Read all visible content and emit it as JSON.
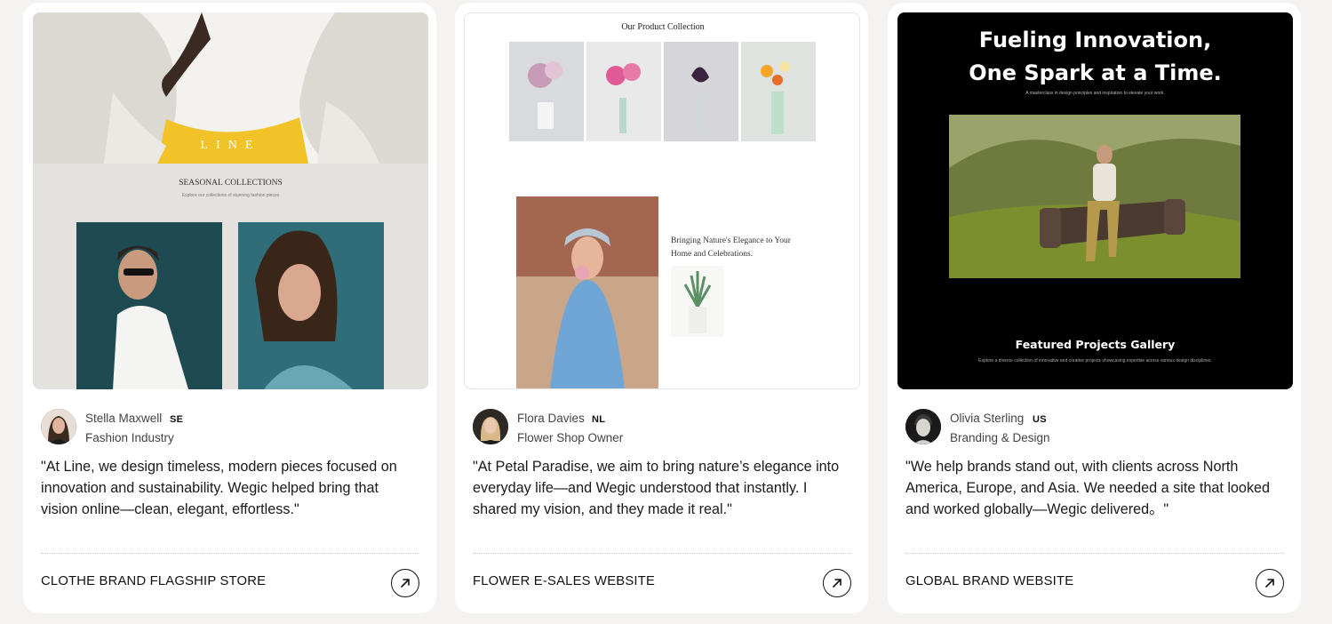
{
  "cards": [
    {
      "preview": {
        "logo": "LINE",
        "heading": "SEASONAL COLLECTIONS",
        "subheading": "Explore our collections of stunning fashion pieces"
      },
      "author": {
        "name": "Stella Maxwell",
        "country": "SE",
        "role": "Fashion Industry"
      },
      "quote": "\"At Line, we design timeless, modern pieces focused on innovation and sustainability. Wegic helped bring that vision online—clean, elegant, effortless.\"",
      "project": "CLOTHE BRAND FLAGSHIP STORE",
      "link_icon": "arrow-up-right-icon"
    },
    {
      "preview": {
        "heading": "Our Product Collection",
        "feature_heading": "Bringing Nature's Elegance to Your Home and Celebrations."
      },
      "author": {
        "name": "Flora Davies",
        "country": "NL",
        "role": "Flower Shop Owner"
      },
      "quote": "\"At Petal Paradise, we aim to bring nature’s elegance into everyday life—and Wegic understood that instantly. I shared my vision, and they made it real.\"",
      "project": "FLOWER E-SALES WEBSITE",
      "link_icon": "arrow-up-right-icon"
    },
    {
      "preview": {
        "heading_line1": "Fueling Innovation,",
        "heading_line2": "One Spark at a Time.",
        "subheading": "A masterclass in design principles and inspiration to elevate your work.",
        "gallery_heading": "Featured Projects Gallery",
        "gallery_subheading": "Explore a diverse collection of innovative and creative projects showcasing expertise across various design disciplines."
      },
      "author": {
        "name": "Olivia Sterling",
        "country": "US",
        "role": "Branding & Design"
      },
      "quote": "\"We help brands stand out, with clients across North America, Europe, and Asia. We needed a site that looked and worked globally—Wegic delivered。\"",
      "project": "GLOBAL BRAND WEBSITE",
      "link_icon": "arrow-up-right-icon"
    }
  ]
}
